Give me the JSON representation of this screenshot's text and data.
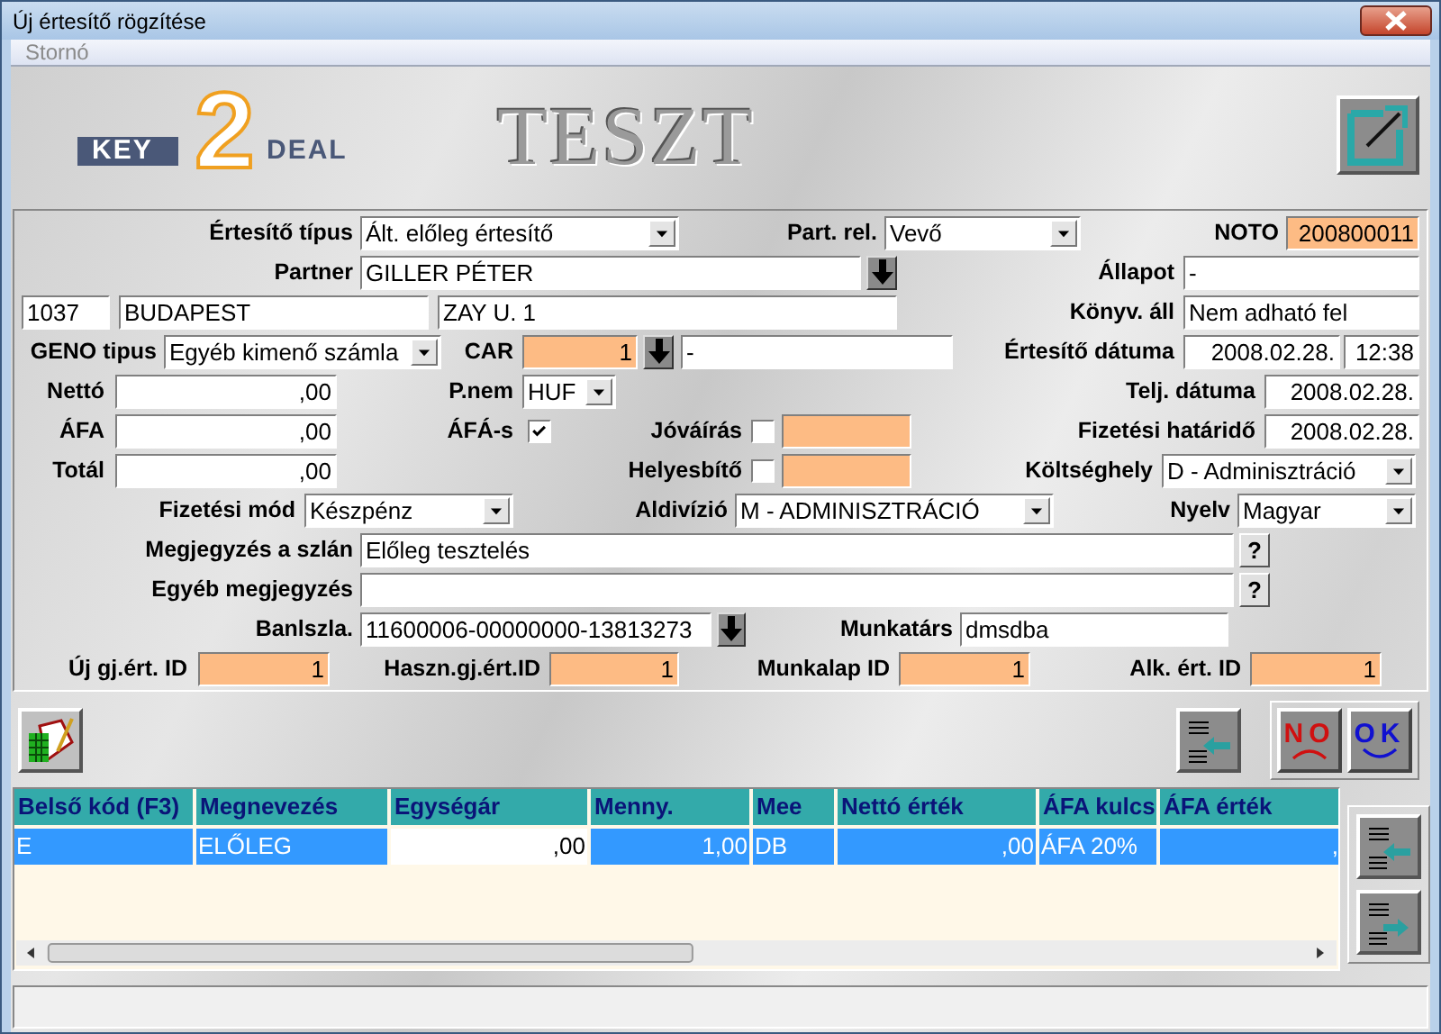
{
  "window": {
    "title": "Új értesítő rögzítése"
  },
  "menu": [
    {
      "label": "Stornó",
      "disabled": true
    }
  ],
  "banner": {
    "logo": {
      "left": "KEY",
      "middle": "2",
      "right": "DEAL"
    },
    "environment": "TESZT"
  },
  "form": {
    "lines": [
      [
        {
          "kind": "label",
          "text": "Értesítő típus"
        },
        {
          "kind": "select",
          "value": "Ált. előleg értesítő"
        },
        {
          "kind": "label",
          "text": "Part. rel."
        },
        {
          "kind": "select",
          "value": "Vevő"
        },
        {
          "kind": "label",
          "text": "NOTO"
        },
        {
          "kind": "number-field",
          "value": "200800011",
          "highlighted": true
        }
      ],
      [
        {
          "kind": "label",
          "text": "Partner"
        },
        {
          "kind": "text-field",
          "value": "GILLER PÉTER",
          "highlighted": false
        },
        {
          "kind": "lookup-button"
        },
        {
          "kind": "label",
          "text": "Állapot"
        },
        {
          "kind": "text-field",
          "value": "-",
          "highlighted": false
        }
      ],
      [
        {
          "kind": "text-field",
          "value": "1037",
          "highlighted": false
        },
        {
          "kind": "text-field",
          "value": "BUDAPEST",
          "highlighted": false
        },
        {
          "kind": "text-field",
          "value": "ZAY U. 1",
          "highlighted": false
        },
        {
          "kind": "label",
          "text": "Könyv. áll"
        },
        {
          "kind": "text-field",
          "value": "Nem adható fel",
          "highlighted": false
        }
      ],
      [
        {
          "kind": "label",
          "text": "GENO tipus"
        },
        {
          "kind": "select",
          "value": "Egyéb kimenő számla"
        },
        {
          "kind": "label",
          "text": "CAR"
        },
        {
          "kind": "number-field",
          "value": "1",
          "highlighted": true
        },
        {
          "kind": "lookup-button"
        },
        {
          "kind": "text-field",
          "value": "-",
          "highlighted": false
        },
        {
          "kind": "label",
          "text": "Értesítő dátuma"
        },
        {
          "kind": "number-field",
          "value": "2008.02.28.",
          "highlighted": false
        },
        {
          "kind": "number-field",
          "value": "12:38",
          "highlighted": false
        }
      ],
      [
        {
          "kind": "label",
          "text": "Nettó"
        },
        {
          "kind": "number-field",
          "value": ",00",
          "highlighted": false
        },
        {
          "kind": "label",
          "text": "P.nem"
        },
        {
          "kind": "select",
          "value": "HUF"
        },
        {
          "kind": "label",
          "text": "Telj. dátuma"
        },
        {
          "kind": "number-field",
          "value": "2008.02.28.",
          "highlighted": false
        }
      ],
      [
        {
          "kind": "label",
          "text": "ÁFA"
        },
        {
          "kind": "number-field",
          "value": ",00",
          "highlighted": false
        },
        {
          "kind": "label",
          "text": "ÁFÁ-s"
        },
        {
          "kind": "checkbox",
          "checked": true
        },
        {
          "kind": "label",
          "text": "Jóváírás"
        },
        {
          "kind": "checkbox",
          "checked": false
        },
        {
          "kind": "text-field",
          "highlighted": true
        },
        {
          "kind": "label",
          "text": "Fizetési határidő"
        },
        {
          "kind": "number-field",
          "value": "2008.02.28.",
          "highlighted": false
        }
      ],
      [
        {
          "kind": "label",
          "text": "Totál"
        },
        {
          "kind": "number-field",
          "value": ",00",
          "highlighted": false
        },
        {
          "kind": "label",
          "text": "Helyesbítő"
        },
        {
          "kind": "checkbox",
          "checked": false
        },
        {
          "kind": "text-field",
          "highlighted": true
        },
        {
          "kind": "label",
          "text": "Költséghely"
        },
        {
          "kind": "select",
          "value": "D - Adminisztráció"
        }
      ],
      [
        {
          "kind": "label",
          "text": "Fizetési mód"
        },
        {
          "kind": "select",
          "value": "Készpénz"
        },
        {
          "kind": "label",
          "text": "Aldivízió"
        },
        {
          "kind": "select",
          "value": "M - ADMINISZTRÁCIÓ"
        },
        {
          "kind": "label",
          "text": "Nyelv"
        },
        {
          "kind": "select",
          "value": "Magyar"
        }
      ],
      [
        {
          "kind": "label",
          "text": "Megjegyzés a szlán"
        },
        {
          "kind": "text-field",
          "value": "Előleg tesztelés",
          "highlighted": false
        },
        {
          "kind": "help-button",
          "text": "?"
        }
      ],
      [
        {
          "kind": "label",
          "text": "Egyéb megjegyzés"
        },
        {
          "kind": "text-field",
          "highlighted": false
        },
        {
          "kind": "help-button",
          "text": "?"
        }
      ],
      [
        {
          "kind": "label",
          "text": "Banlszla."
        },
        {
          "kind": "text-field",
          "value": "11600006-00000000-13813273",
          "highlighted": false
        },
        {
          "kind": "lookup-button"
        },
        {
          "kind": "label",
          "text": "Munkatárs"
        },
        {
          "kind": "text-field",
          "value": "dmsdba",
          "highlighted": false
        }
      ],
      [
        {
          "kind": "label",
          "text": "Új gj.ért. ID"
        },
        {
          "kind": "number-field",
          "value": "1",
          "highlighted": true
        },
        {
          "kind": "label",
          "text": "Haszn.gj.ért.ID"
        },
        {
          "kind": "number-field",
          "value": "1",
          "highlighted": true
        },
        {
          "kind": "label",
          "text": "Munkalap ID"
        },
        {
          "kind": "number-field",
          "value": "1",
          "highlighted": true
        },
        {
          "kind": "label",
          "text": "Alk. ért. ID"
        },
        {
          "kind": "number-field",
          "value": "1",
          "highlighted": true
        }
      ]
    ]
  },
  "actions": {
    "cancel": "NO",
    "ok": "OK"
  },
  "table": {
    "columns": [
      {
        "label": "Belső kód (F3)",
        "kind": "text"
      },
      {
        "label": "Megnevezés",
        "kind": "text"
      },
      {
        "label": "Egységár",
        "kind": "number"
      },
      {
        "label": "Menny.",
        "kind": "number"
      },
      {
        "label": "Mee",
        "kind": "text"
      },
      {
        "label": "Nettó érték",
        "kind": "number"
      },
      {
        "label": "ÁFA kulcs",
        "kind": "text"
      },
      {
        "label": "ÁFA érték",
        "kind": "number"
      }
    ],
    "rows": [
      {
        "selected": true,
        "cells": [
          {
            "text": "E",
            "focused": false
          },
          {
            "text": "ELŐLEG",
            "focused": false
          },
          {
            "text": ",00",
            "focused": true
          },
          {
            "text": "1,00",
            "focused": false
          },
          {
            "text": "DB",
            "focused": false
          },
          {
            "text": ",00",
            "focused": false
          },
          {
            "text": "ÁFA 20%",
            "focused": false
          },
          {
            "text": ",",
            "focused": false
          }
        ]
      }
    ]
  }
}
